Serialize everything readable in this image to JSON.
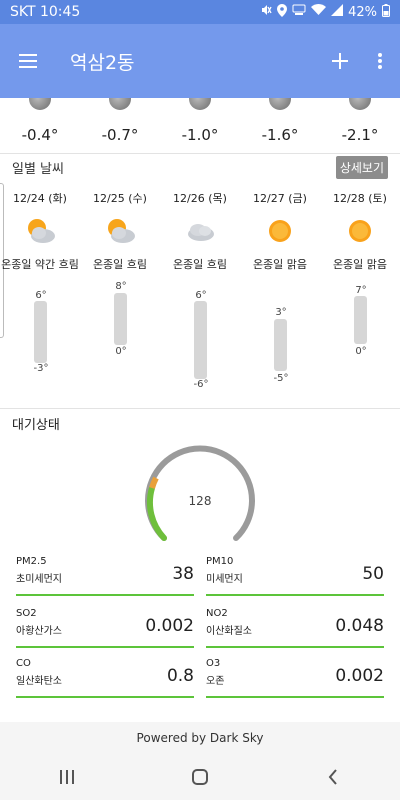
{
  "status": {
    "time": "SKT 10:45",
    "battery": "42%"
  },
  "app": {
    "title": "역삼2동"
  },
  "hourly": [
    {
      "temp": "-0.4°"
    },
    {
      "temp": "-0.7°"
    },
    {
      "temp": "-1.0°"
    },
    {
      "temp": "-1.6°"
    },
    {
      "temp": "-2.1°"
    }
  ],
  "daily": {
    "title": "일별 날씨",
    "detail_label": "상세보기",
    "days": [
      {
        "date": "12/24 (화)",
        "icon": "partly-cloudy-icon",
        "desc": "온종일 약간 흐림",
        "high": "6°",
        "low": "-3°"
      },
      {
        "date": "12/25 (수)",
        "icon": "partly-cloudy-icon",
        "desc": "온종일 흐림",
        "high": "8°",
        "low": "0°"
      },
      {
        "date": "12/26 (목)",
        "icon": "cloudy-icon",
        "desc": "온종일 흐림",
        "high": "6°",
        "low": "-6°"
      },
      {
        "date": "12/27 (금)",
        "icon": "sun-icon",
        "desc": "온종일 맑음",
        "high": "3°",
        "low": "-5°"
      },
      {
        "date": "12/28 (토)",
        "icon": "sun-icon",
        "desc": "온종일 맑음",
        "high": "7°",
        "low": "0°"
      }
    ]
  },
  "air": {
    "title": "대기상태",
    "gauge_value": "128",
    "metrics": [
      {
        "name": "PM2.5",
        "kor": "초미세먼지",
        "value": "38"
      },
      {
        "name": "PM10",
        "kor": "미세먼지",
        "value": "50"
      },
      {
        "name": "SO2",
        "kor": "아황산가스",
        "value": "0.002"
      },
      {
        "name": "NO2",
        "kor": "이산화질소",
        "value": "0.048"
      },
      {
        "name": "CO",
        "kor": "일산화탄소",
        "value": "0.8"
      },
      {
        "name": "O3",
        "kor": "오존",
        "value": "0.002"
      }
    ]
  },
  "footer": {
    "powered": "Powered by Dark Sky"
  },
  "colors": {
    "statusbar": "#5a86e0",
    "appbar": "#7499ec",
    "metric_line": "#5cc43a"
  }
}
